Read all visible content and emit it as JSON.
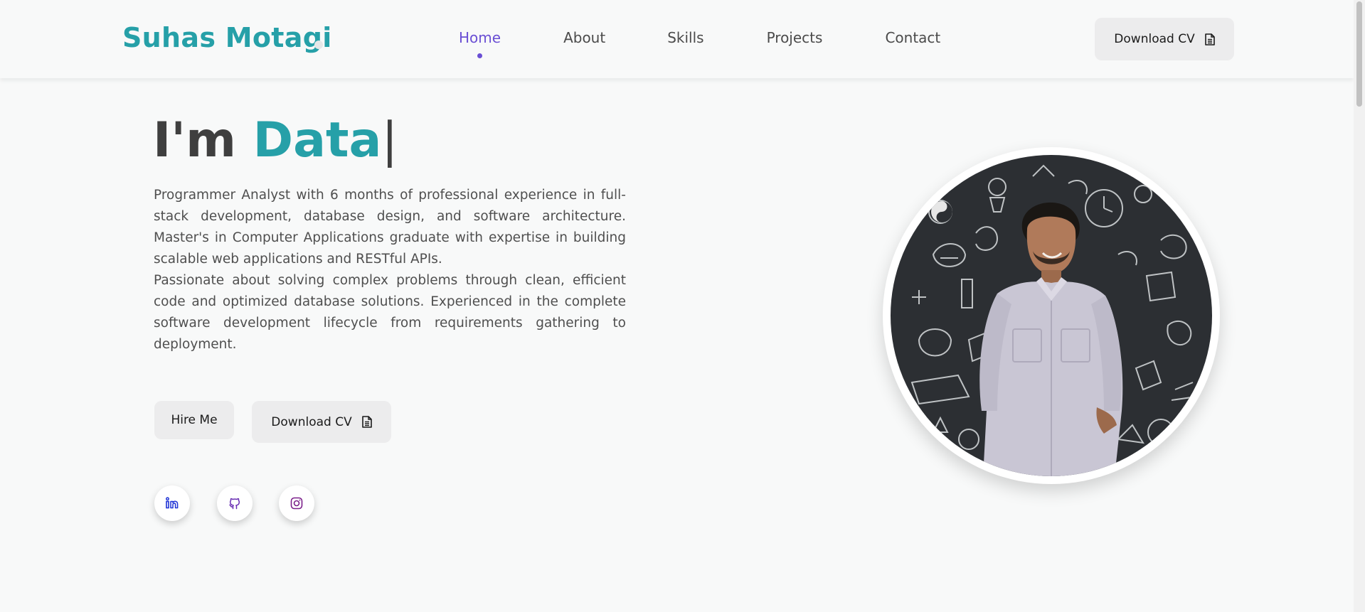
{
  "header": {
    "logo": "Suhas Motagi",
    "nav": [
      "Home",
      "About",
      "Skills",
      "Projects",
      "Contact"
    ],
    "active_nav": "Home",
    "download_cv": "Download CV"
  },
  "hero": {
    "greeting": "I'm ",
    "typed_text": "Data",
    "cursor": "|",
    "bio": [
      "Programmer Analyst with 6 months of professional experience in full-stack development, database design, and software architecture. Master's in Computer Applications graduate with expertise in building scalable web applications and RESTful APIs.",
      "Passionate about solving complex problems through clean, efficient code and optimized database solutions. Experienced in the complete software development lifecycle from requirements gathering to deployment."
    ],
    "hire_button": "Hire Me",
    "download_button": "Download CV"
  },
  "social": [
    "linkedin-icon",
    "github-icon",
    "instagram-icon"
  ],
  "colors": {
    "brand": "#26a0a8",
    "accent": "#6a4fd4",
    "background": "#f8f9f9",
    "button_bg": "#ececed"
  },
  "portrait": {
    "icon": "profile-photo"
  }
}
